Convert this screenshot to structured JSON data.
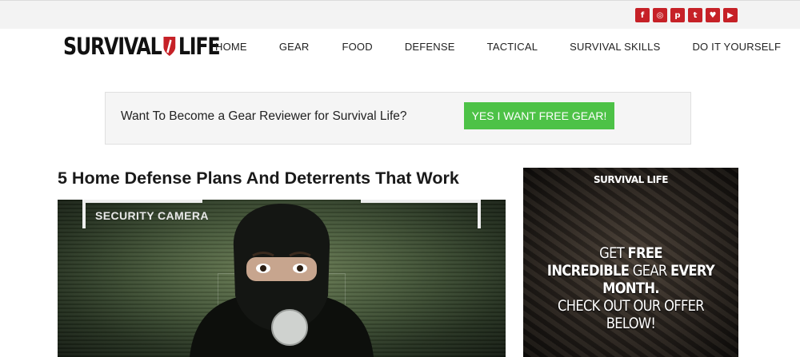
{
  "social": [
    {
      "icon": "facebook-icon",
      "glyph": "f"
    },
    {
      "icon": "instagram-icon",
      "glyph": "◎"
    },
    {
      "icon": "pinterest-icon",
      "glyph": "p"
    },
    {
      "icon": "tumblr-icon",
      "glyph": "t"
    },
    {
      "icon": "twitter-icon",
      "glyph": "♥"
    },
    {
      "icon": "youtube-icon",
      "glyph": "▶"
    }
  ],
  "logo": {
    "left": "SURVIVAL",
    "right": "LIFE"
  },
  "nav": [
    "HOME",
    "GEAR",
    "FOOD",
    "DEFENSE",
    "TACTICAL",
    "SURVIVAL SKILLS",
    "DO IT YOURSELF"
  ],
  "promo": {
    "text": "Want To Become a Gear Reviewer for Survival Life?",
    "button": "YES I WANT FREE GEAR!"
  },
  "post": {
    "title": "5 Home Defense Plans And Deterrents That Work",
    "image_label": "SECURITY CAMERA"
  },
  "ad": {
    "logo": "SURVIVAL LIFE",
    "line1a": "GET ",
    "line1b": "FREE",
    "line2a": "INCREDIBLE",
    "line2b": " GEAR ",
    "line2c": "EVERY MONTH.",
    "line3": "CHECK OUT OUR OFFER BELOW!"
  },
  "colors": {
    "brand_red": "#c62127",
    "cta_green": "#4dc247"
  }
}
